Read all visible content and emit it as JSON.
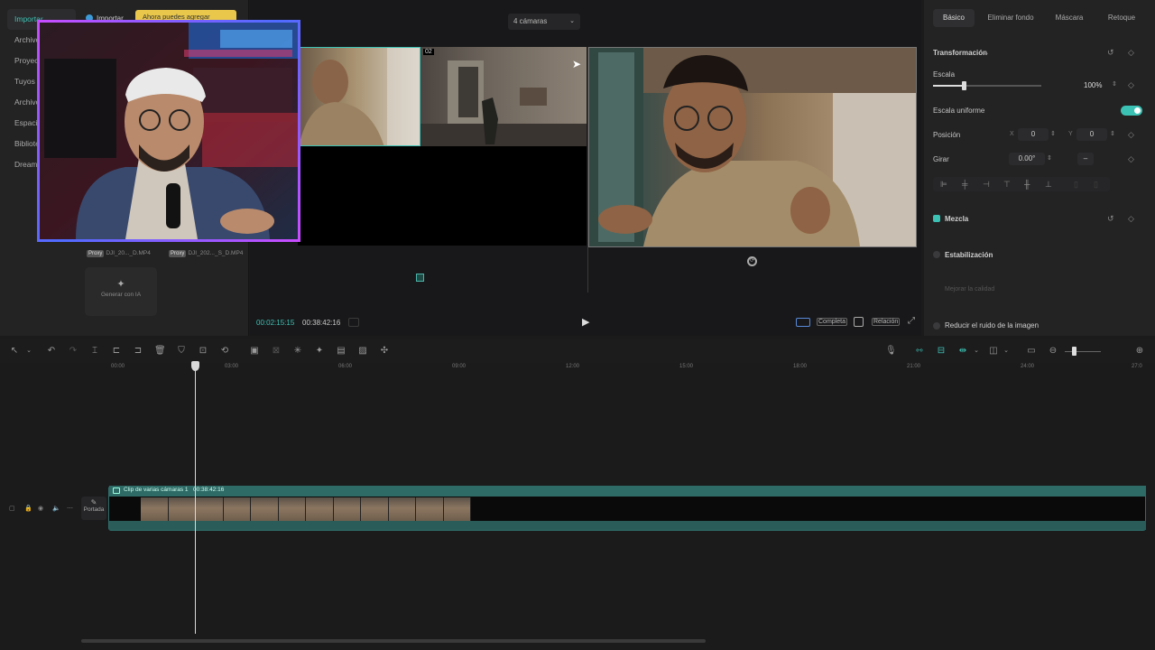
{
  "left_panel": {
    "nav": [
      {
        "label": "Importar",
        "active": true
      },
      {
        "label": "Archivo",
        "active": false
      },
      {
        "label": "Proyect",
        "active": false
      },
      {
        "label": "Tuyos",
        "active": false
      },
      {
        "label": "Archivo",
        "active": false
      },
      {
        "label": "Espacio",
        "active": false
      },
      {
        "label": "Bibliote",
        "active": false
      },
      {
        "label": "Dreami",
        "active": false
      }
    ],
    "import_label": "Importar",
    "tooltip": "Ahora puedes agregar",
    "media": [
      {
        "proxy": "Proxy",
        "name": "DJI_20..._D.MP4"
      },
      {
        "proxy": "Proxy",
        "name": "DJI_202..._S_D.MP4"
      }
    ],
    "generate_ai": "Generar con IA"
  },
  "preview": {
    "camera_select": "4 cámaras",
    "cam2_badge": "02",
    "current_time": "00:02:15:15",
    "total_time": "00:38:42:16",
    "full_label": "Completa",
    "ratio_label": "Relación"
  },
  "right_panel": {
    "tabs": [
      "Básico",
      "Eliminar fondo",
      "Máscara",
      "Retoque"
    ],
    "transform_title": "Transformación",
    "scale_label": "Escala",
    "scale_value": "100%",
    "scale_fraction": 0.28,
    "uniform_scale_label": "Escala uniforme",
    "position_label": "Posición",
    "pos_x_label": "X",
    "pos_x": "0",
    "pos_y_label": "Y",
    "pos_y": "0",
    "rotate_label": "Girar",
    "rotate_value": "0.00°",
    "rotate_minus": "–",
    "blend_label": "Mezcla",
    "stabilization_label": "Estabilización",
    "improve_quality_label": "Mejorar la calidad",
    "noise_label": "Reducir el ruido de la imagen"
  },
  "timeline": {
    "ruler": [
      "00:00",
      "03:00",
      "06:00",
      "09:00",
      "12:00",
      "15:00",
      "18:00",
      "21:00",
      "24:00",
      "27:0"
    ],
    "cover_label": "Portada",
    "clip_title": "Clip de varias cámaras 1",
    "clip_duration": "00:38:42:16"
  },
  "colors": {
    "accent": "#3cc2b4",
    "track": "#2e6a66"
  }
}
